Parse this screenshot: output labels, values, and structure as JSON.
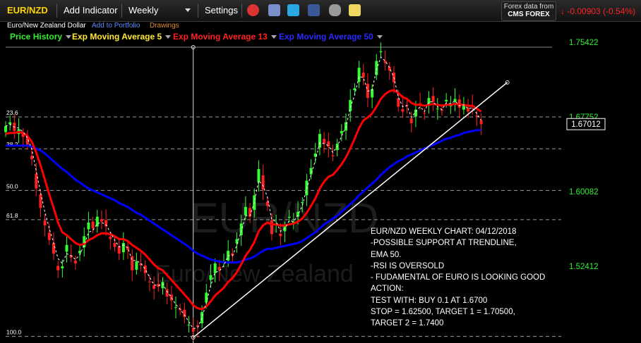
{
  "toolbar": {
    "symbol": "EUR/NZD",
    "add_indicator": "Add Indicator",
    "period": "Weekly",
    "settings": "Settings",
    "source_line1": "Forex data from",
    "source_line2": "CMS FOREX",
    "change": "-0.00903 (-0.54%)"
  },
  "subheader": {
    "instrument": "Euro/New Zealand Dollar",
    "add_portfolio": "Add to Portfolio",
    "drawings": "Drawings"
  },
  "colors": {
    "price_up": "#33ff33",
    "price_down": "#ff2020",
    "ema5": "#ffffff",
    "ema13": "#ff0000",
    "ema50": "#0000ff",
    "trendline": "#ffffff",
    "price_axis": "#33ee33"
  },
  "watermark": {
    "symbol": "EUR/NZD",
    "name": "Euro/New Zealand"
  },
  "annotation": [
    "EUR/NZD WEEKLY CHART: 04/12/2018",
    "-POSSIBLE SUPPORT AT TRENDLINE,",
    "EMA 50.",
    "-RSI IS OVERSOLD",
    "- FUDAMENTAL OF EURO IS LOOKING GOOD",
    "ACTION:",
    "TEST WITH: BUY 0.1 AT 1.6700",
    "STOP = 1.62500, TARGET 1 = 1.70500,",
    "TARGET 2 = 1.7400"
  ],
  "chart_data": {
    "type": "candlestick",
    "series_names": [
      "Price History",
      "Exp Moving Average 5",
      "Exp Moving Average 13",
      "Exp Moving Average 50"
    ],
    "y_ticks": [
      1.75422,
      1.67752,
      1.60082,
      1.52412
    ],
    "current_price": 1.67012,
    "ylim": [
      1.45,
      1.76
    ],
    "fib_levels": [
      {
        "label": "23.6",
        "value": 1.6775
      },
      {
        "label": "38.2",
        "value": 1.6448
      },
      {
        "label": "50.0",
        "value": 1.602
      },
      {
        "label": "61.8",
        "value": 1.572
      },
      {
        "label": "100.0",
        "value": 1.452
      }
    ],
    "candles_close": [
      1.668,
      1.672,
      1.663,
      1.665,
      1.657,
      1.649,
      1.634,
      1.604,
      1.584,
      1.566,
      1.551,
      1.537,
      1.52,
      1.524,
      1.546,
      1.533,
      1.527,
      1.54,
      1.555,
      1.569,
      1.563,
      1.575,
      1.57,
      1.565,
      1.552,
      1.544,
      1.537,
      1.548,
      1.541,
      1.52,
      1.529,
      1.525,
      1.517,
      1.508,
      1.501,
      1.503,
      1.508,
      1.493,
      1.489,
      1.482,
      1.479,
      1.472,
      1.464,
      1.457,
      1.462,
      1.477,
      1.497,
      1.515,
      1.527,
      1.52,
      1.528,
      1.54,
      1.535,
      1.552,
      1.568,
      1.585,
      1.575,
      1.597,
      1.624,
      1.603,
      1.586,
      1.557,
      1.568,
      1.555,
      1.565,
      1.575,
      1.57,
      1.58,
      1.59,
      1.612,
      1.625,
      1.64,
      1.66,
      1.65,
      1.647,
      1.637,
      1.65,
      1.663,
      1.672,
      1.695,
      1.707,
      1.728,
      1.718,
      1.697,
      1.706,
      1.735,
      1.745,
      1.733,
      1.725,
      1.713,
      1.688,
      1.683,
      1.689,
      1.671,
      1.685,
      1.69,
      1.681,
      1.697,
      1.693,
      1.686,
      1.684,
      1.695,
      1.69,
      1.696,
      1.687,
      1.691,
      1.683,
      1.688,
      1.678,
      1.67
    ],
    "ema5": [
      1.668,
      1.67,
      1.667,
      1.666,
      1.662,
      1.656,
      1.644,
      1.622,
      1.6,
      1.58,
      1.563,
      1.548,
      1.532,
      1.527,
      1.537,
      1.535,
      1.531,
      1.536,
      1.546,
      1.559,
      1.561,
      1.568,
      1.569,
      1.567,
      1.559,
      1.551,
      1.544,
      1.546,
      1.543,
      1.53,
      1.53,
      1.527,
      1.521,
      1.513,
      1.505,
      1.504,
      1.506,
      1.498,
      1.492,
      1.485,
      1.48,
      1.474,
      1.467,
      1.46,
      1.461,
      1.471,
      1.487,
      1.504,
      1.518,
      1.519,
      1.525,
      1.535,
      1.535,
      1.546,
      1.56,
      1.576,
      1.576,
      1.59,
      1.612,
      1.607,
      1.595,
      1.572,
      1.57,
      1.56,
      1.563,
      1.571,
      1.57,
      1.577,
      1.586,
      1.604,
      1.618,
      1.633,
      1.651,
      1.65,
      1.648,
      1.641,
      1.647,
      1.658,
      1.667,
      1.687,
      1.7,
      1.719,
      1.718,
      1.704,
      1.705,
      1.726,
      1.739,
      1.735,
      1.728,
      1.718,
      1.698,
      1.688,
      1.689,
      1.677,
      1.683,
      1.688,
      1.683,
      1.693,
      1.693,
      1.688,
      1.685,
      1.692,
      1.691,
      1.694,
      1.689,
      1.69,
      1.686,
      1.687,
      1.681,
      1.674
    ],
    "ema13": [
      1.66,
      1.661,
      1.661,
      1.662,
      1.661,
      1.658,
      1.652,
      1.641,
      1.628,
      1.613,
      1.598,
      1.584,
      1.569,
      1.559,
      1.556,
      1.552,
      1.548,
      1.546,
      1.547,
      1.551,
      1.553,
      1.556,
      1.558,
      1.558,
      1.557,
      1.555,
      1.552,
      1.552,
      1.55,
      1.546,
      1.543,
      1.54,
      1.536,
      1.531,
      1.526,
      1.522,
      1.52,
      1.515,
      1.51,
      1.505,
      1.5,
      1.495,
      1.49,
      1.484,
      1.481,
      1.48,
      1.483,
      1.488,
      1.494,
      1.498,
      1.502,
      1.508,
      1.512,
      1.518,
      1.526,
      1.535,
      1.541,
      1.549,
      1.56,
      1.566,
      1.569,
      1.567,
      1.567,
      1.566,
      1.566,
      1.567,
      1.568,
      1.57,
      1.573,
      1.579,
      1.586,
      1.594,
      1.604,
      1.611,
      1.616,
      1.618,
      1.623,
      1.629,
      1.636,
      1.645,
      1.655,
      1.666,
      1.674,
      1.677,
      1.681,
      1.688,
      1.696,
      1.701,
      1.704,
      1.705,
      1.702,
      1.698,
      1.696,
      1.692,
      1.69,
      1.69,
      1.689,
      1.69,
      1.691,
      1.69,
      1.689,
      1.69,
      1.69,
      1.691,
      1.69,
      1.69,
      1.689,
      1.689,
      1.686,
      1.683
    ],
    "ema50": [
      1.648,
      1.648,
      1.648,
      1.648,
      1.648,
      1.648,
      1.647,
      1.645,
      1.643,
      1.64,
      1.636,
      1.632,
      1.628,
      1.624,
      1.621,
      1.617,
      1.613,
      1.61,
      1.607,
      1.604,
      1.602,
      1.6,
      1.598,
      1.596,
      1.594,
      1.592,
      1.589,
      1.587,
      1.585,
      1.582,
      1.579,
      1.577,
      1.574,
      1.571,
      1.568,
      1.565,
      1.562,
      1.559,
      1.556,
      1.553,
      1.55,
      1.547,
      1.544,
      1.54,
      1.537,
      1.535,
      1.533,
      1.531,
      1.53,
      1.529,
      1.528,
      1.528,
      1.528,
      1.528,
      1.529,
      1.531,
      1.532,
      1.534,
      1.537,
      1.54,
      1.542,
      1.542,
      1.543,
      1.544,
      1.545,
      1.546,
      1.547,
      1.548,
      1.55,
      1.553,
      1.556,
      1.559,
      1.563,
      1.567,
      1.57,
      1.573,
      1.576,
      1.58,
      1.584,
      1.588,
      1.592,
      1.597,
      1.601,
      1.605,
      1.609,
      1.613,
      1.618,
      1.622,
      1.626,
      1.629,
      1.632,
      1.634,
      1.637,
      1.639,
      1.641,
      1.643,
      1.645,
      1.647,
      1.649,
      1.651,
      1.653,
      1.655,
      1.656,
      1.658,
      1.659,
      1.661,
      1.662,
      1.663,
      1.664,
      1.664
    ],
    "trendline": [
      [
        43,
        1.451
      ],
      [
        115,
        1.713
      ]
    ],
    "vertical_marker_index": 43
  }
}
